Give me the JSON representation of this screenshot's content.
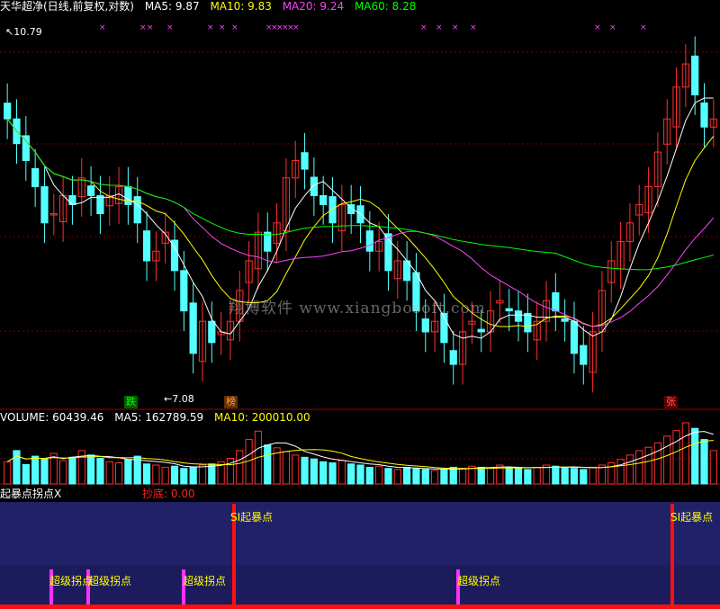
{
  "chart_data": [
    {
      "type": "candlestick",
      "title": "天华超净(日线,前复权,对数)",
      "overlays": [
        {
          "name": "MA5",
          "value": "9.87",
          "color": "#ffffff"
        },
        {
          "name": "MA10",
          "value": "9.83",
          "color": "#ffff00"
        },
        {
          "name": "MA20",
          "value": "9.24",
          "color": "#ff40ff"
        },
        {
          "name": "MA60",
          "value": "8.28",
          "color": "#00ff00"
        }
      ],
      "high_note": "10.79",
      "low_note": "7.08",
      "markers": [
        {
          "label": "跌",
          "color": "#00c000"
        },
        {
          "label": "榜",
          "color": "#ff8000"
        },
        {
          "label": "张",
          "color": "#ff2020"
        }
      ],
      "up_color": "#ff3030",
      "down_color": "#54ffff",
      "ylim": [
        7.0,
        10.9
      ],
      "series_close": [
        9.8,
        9.5,
        9.3,
        9.0,
        8.6,
        8.7,
        8.9,
        8.8,
        9.1,
        8.9,
        8.7,
        8.9,
        9.0,
        8.8,
        8.6,
        8.2,
        8.3,
        8.5,
        8.1,
        7.7,
        7.3,
        7.6,
        7.4,
        7.5,
        7.6,
        7.9,
        8.2,
        8.5,
        8.3,
        8.6,
        9.1,
        9.3,
        9.2,
        8.9,
        8.8,
        8.6,
        8.8,
        8.7,
        8.6,
        8.3,
        8.4,
        8.1,
        8.2,
        8.0,
        7.7,
        7.5,
        7.6,
        7.4,
        7.2,
        7.5,
        7.6,
        7.5,
        7.7,
        7.8,
        7.7,
        7.6,
        7.5,
        7.6,
        7.8,
        7.7,
        7.6,
        7.3,
        7.2,
        7.5,
        7.9,
        8.2,
        8.4,
        8.6,
        8.8,
        9.0,
        9.4,
        9.8,
        10.2,
        10.5,
        10.1,
        9.7,
        9.8
      ],
      "ma5_values": "9.87",
      "ma10_values": "9.83"
    },
    {
      "type": "bar",
      "title": "VOLUME",
      "labels": [
        {
          "name": "VOLUME",
          "value": "60439.46",
          "color": "#ffffff"
        },
        {
          "name": "MA5",
          "value": "162789.59",
          "color": "#ffffff"
        },
        {
          "name": "MA10",
          "value": "200010.00",
          "color": "#ffff00"
        }
      ],
      "values": [
        40,
        60,
        35,
        50,
        45,
        55,
        42,
        48,
        60,
        52,
        46,
        40,
        38,
        44,
        50,
        36,
        34,
        30,
        32,
        28,
        30,
        34,
        36,
        40,
        46,
        60,
        80,
        95,
        70,
        65,
        58,
        52,
        48,
        45,
        40,
        38,
        42,
        36,
        34,
        30,
        32,
        28,
        26,
        30,
        28,
        26,
        24,
        26,
        30,
        28,
        32,
        30,
        28,
        34,
        30,
        28,
        26,
        30,
        34,
        32,
        30,
        28,
        26,
        30,
        34,
        38,
        44,
        52,
        60,
        66,
        74,
        86,
        96,
        110,
        100,
        80,
        60
      ]
    },
    {
      "type": "bar",
      "title": "起暴点拐点X",
      "labels": [
        {
          "name": "抄底",
          "value": "0.00",
          "color": "#ff2020"
        }
      ],
      "annotations": [
        "SI起暴点",
        "超级拐点",
        "超级拐点",
        "超级拐点",
        "超级拐点",
        "SI起暴点"
      ]
    }
  ],
  "watermark": "翔博软件  www.xiangbosoft.com"
}
